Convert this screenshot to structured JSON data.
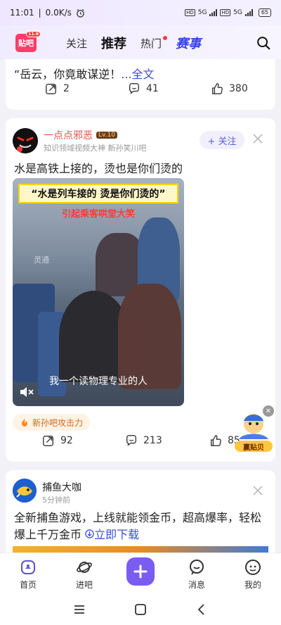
{
  "status_bar": {
    "time": "11:01",
    "speed": "0.0K/s",
    "network_1": "5G",
    "network_2": "5G",
    "battery": "65",
    "hd_label": "HD"
  },
  "topnav": {
    "logo_text": "贴吧",
    "logo_badge": "11.6",
    "tabs": [
      {
        "label": "关注"
      },
      {
        "label": "推荐"
      },
      {
        "label": "热门"
      },
      {
        "label": "赛事"
      }
    ]
  },
  "post1": {
    "text_main": "“岳云，你竟敢谋逆！",
    "text_more": "...全文",
    "shares": "2",
    "comments": "41",
    "likes": "380"
  },
  "post2": {
    "author": "一点点邪恶",
    "level": "Lv.10",
    "author_sub": "知识领域视频大神  新孙笑川吧",
    "follow_label": "+ 关注",
    "title": "水是高铁上接的，烫也是你们烫的",
    "video_banner": "“水是列车接的 烫是你们烫的”",
    "video_banner2": "引起乘客哄堂大笑",
    "video_subtitle": "我一个读物理专业的人",
    "video_watermark": "灵通",
    "tag_label": "新孙吧攻击力",
    "shares": "92",
    "comments": "213",
    "likes": "85"
  },
  "float_badge": {
    "label": "赢贴贝"
  },
  "post3": {
    "author": "捕鱼大咖",
    "time": "5分钟前",
    "text": "全新捕鱼游戏，上线就能领金币，超高爆率，轻松爆上千万金币",
    "download_label": "立即下载"
  },
  "bottom_nav": {
    "items": [
      {
        "label": "首页"
      },
      {
        "label": "进吧"
      },
      {
        "label": "消息"
      },
      {
        "label": "我的"
      }
    ]
  },
  "colors": {
    "accent": "#7b5cf0",
    "link": "#3a4fd8",
    "author_red": "#e0524b"
  }
}
